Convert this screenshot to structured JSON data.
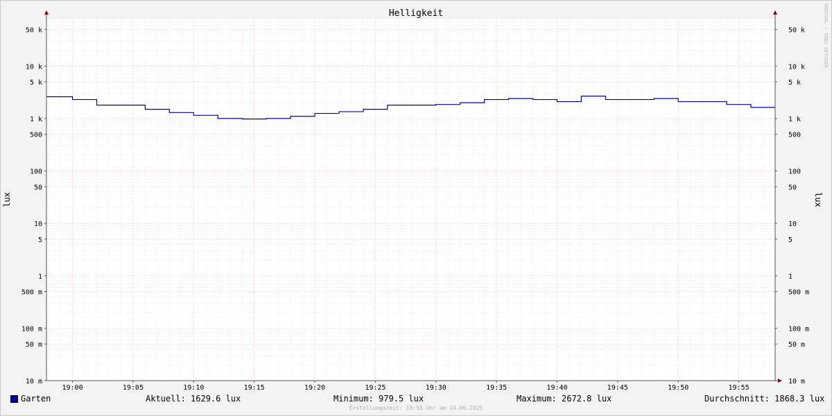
{
  "chart_data": {
    "type": "line",
    "title": "Helligkeit",
    "ylabel": "lux",
    "ylabel_right": "lux",
    "y_scale": "log",
    "ylim": [
      0.01,
      80000
    ],
    "x_ticks": [
      "19:00",
      "19:05",
      "19:10",
      "19:15",
      "19:20",
      "19:25",
      "19:30",
      "19:35",
      "19:40",
      "19:45",
      "19:50",
      "19:55"
    ],
    "y_ticks": [
      {
        "v": 50000,
        "label": "50 k"
      },
      {
        "v": 10000,
        "label": "10 k"
      },
      {
        "v": 5000,
        "label": "5 k"
      },
      {
        "v": 1000,
        "label": "1 k"
      },
      {
        "v": 500,
        "label": "500"
      },
      {
        "v": 100,
        "label": "100"
      },
      {
        "v": 50,
        "label": "50"
      },
      {
        "v": 10,
        "label": "10"
      },
      {
        "v": 5,
        "label": "5"
      },
      {
        "v": 1,
        "label": "1"
      },
      {
        "v": 0.5,
        "label": "500 m"
      },
      {
        "v": 0.1,
        "label": "100 m"
      },
      {
        "v": 0.05,
        "label": "50 m"
      },
      {
        "v": 0.01,
        "label": "10 m"
      }
    ],
    "series": [
      {
        "name": "Garten",
        "color": "#0000a0",
        "steps": [
          {
            "t": "18:58",
            "v": 2600
          },
          {
            "t": "19:00",
            "v": 2300
          },
          {
            "t": "19:02",
            "v": 1800
          },
          {
            "t": "19:06",
            "v": 1500
          },
          {
            "t": "19:08",
            "v": 1300
          },
          {
            "t": "19:10",
            "v": 1150
          },
          {
            "t": "19:12",
            "v": 1000
          },
          {
            "t": "19:14",
            "v": 979.5
          },
          {
            "t": "19:16",
            "v": 1000
          },
          {
            "t": "19:18",
            "v": 1100
          },
          {
            "t": "19:20",
            "v": 1250
          },
          {
            "t": "19:22",
            "v": 1350
          },
          {
            "t": "19:24",
            "v": 1500
          },
          {
            "t": "19:26",
            "v": 1800
          },
          {
            "t": "19:30",
            "v": 1850
          },
          {
            "t": "19:32",
            "v": 2000
          },
          {
            "t": "19:34",
            "v": 2300
          },
          {
            "t": "19:36",
            "v": 2400
          },
          {
            "t": "19:38",
            "v": 2300
          },
          {
            "t": "19:40",
            "v": 2100
          },
          {
            "t": "19:42",
            "v": 2672.8
          },
          {
            "t": "19:44",
            "v": 2300
          },
          {
            "t": "19:48",
            "v": 2400
          },
          {
            "t": "19:50",
            "v": 2100
          },
          {
            "t": "19:54",
            "v": 1850
          },
          {
            "t": "19:56",
            "v": 1629.6
          },
          {
            "t": "19:58",
            "v": 1629.6
          }
        ]
      }
    ],
    "grid": true,
    "legend": "bottom"
  },
  "legend": {
    "series_name": "Garten",
    "current": "Aktuell: 1629.6 lux",
    "minimum": "Minimum: 979.5 lux",
    "maximum": "Maximum: 2672.8 lux",
    "average": "Durchschnitt: 1868.3 lux"
  },
  "footer": "Erstellungszeit: 19:58 Uhr am 14.06.2025",
  "watermark": "RRDTOOL / TOBI OETIKER",
  "colors": {
    "series": "#0000a0",
    "major_grid": "#e8a0a0",
    "minor_grid": "#cccccc",
    "axis_arrow": "#8b0000"
  }
}
